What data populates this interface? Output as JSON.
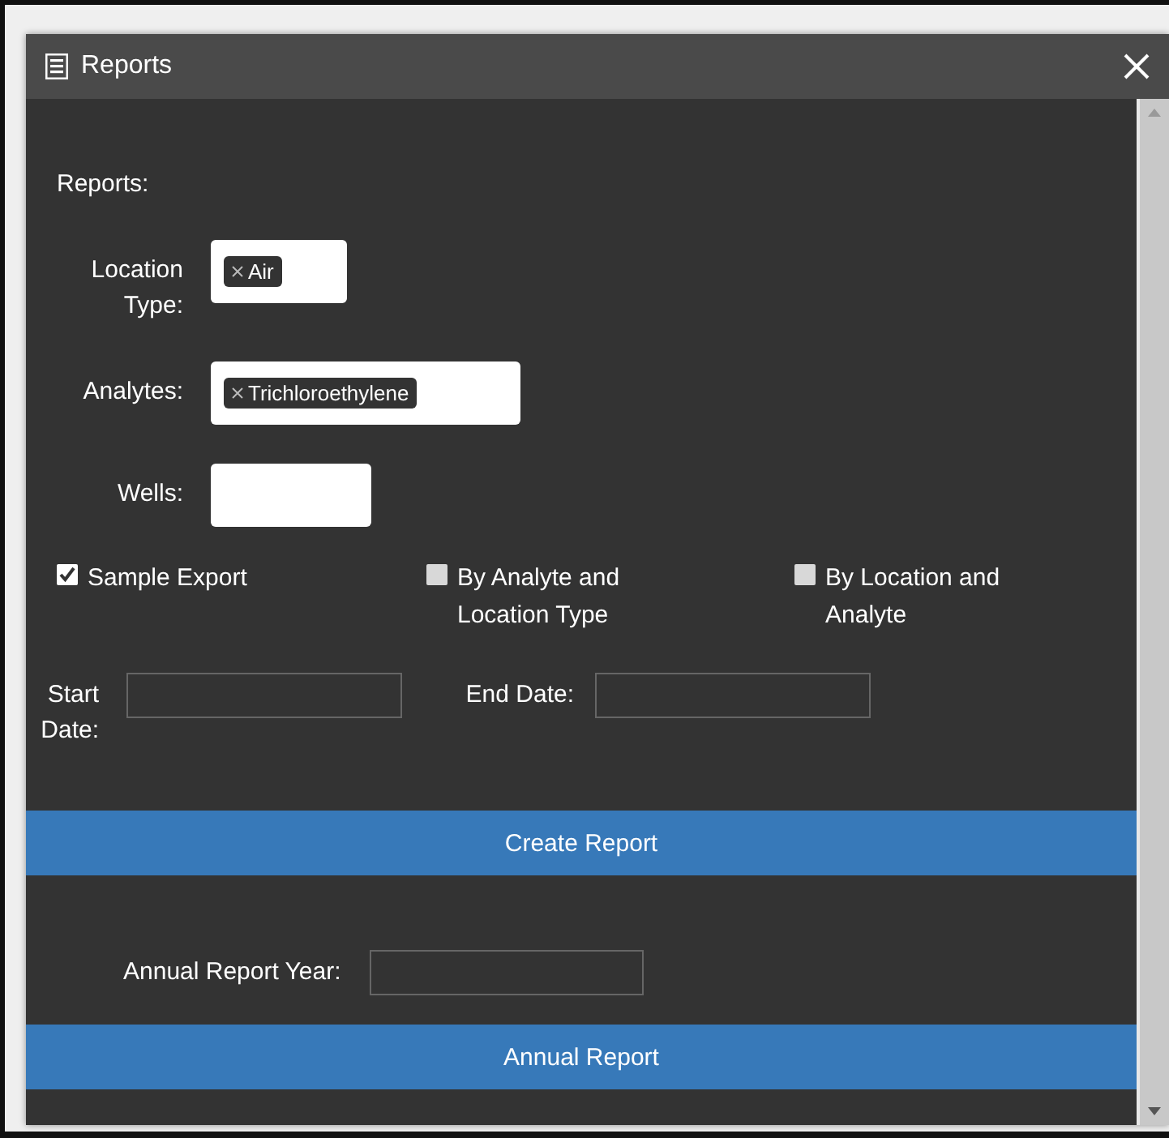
{
  "window": {
    "title": "Reports"
  },
  "section_label": "Reports:",
  "fields": [
    {
      "label": "Location Type:",
      "kind": "tags",
      "tags": [
        "Air"
      ]
    },
    {
      "label": "Analytes:",
      "kind": "tags",
      "tags": [
        "Trichloroethylene"
      ]
    },
    {
      "label": "Wells:",
      "kind": "blank"
    }
  ],
  "checkboxes": [
    {
      "label": "Sample Export",
      "checked": true
    },
    {
      "label": "By Analyte and Location Type",
      "checked": false
    },
    {
      "label": "By Location and Analyte",
      "checked": false
    }
  ],
  "dates": [
    {
      "label": "Start Date:"
    },
    {
      "label": "End Date:"
    }
  ],
  "create_button": "Create Report",
  "annual_field": {
    "label": "Annual Report Year:"
  },
  "annual_button": "Annual Report"
}
